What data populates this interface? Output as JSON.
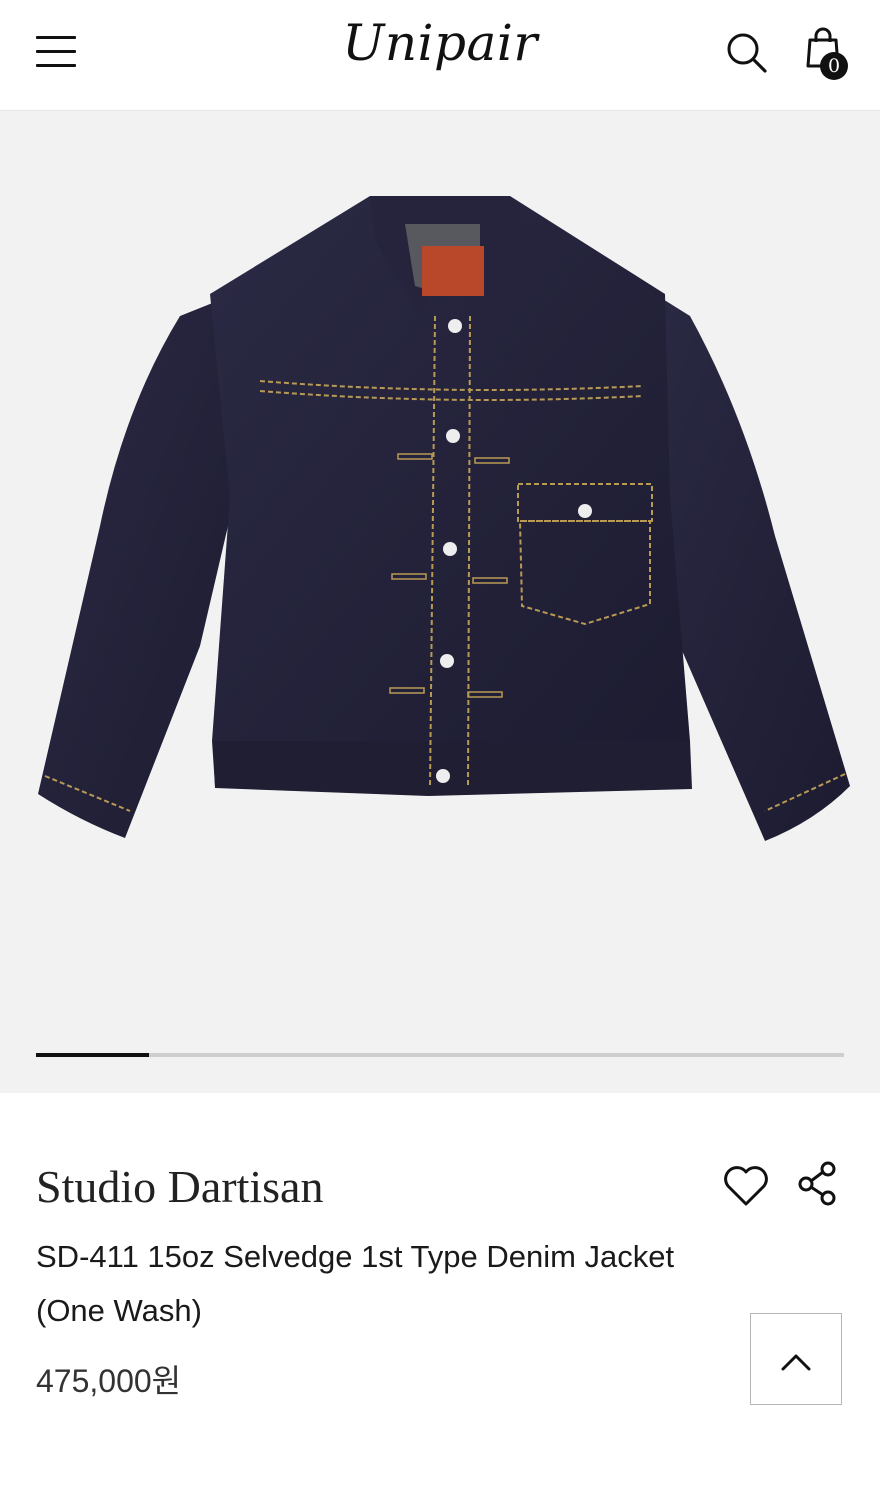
{
  "header": {
    "logo": "Unipair",
    "cart_count": "0",
    "icons": {
      "menu": "hamburger-menu-icon",
      "search": "search-icon",
      "cart": "shopping-bag-icon"
    }
  },
  "gallery": {
    "image": "denim-jacket-product-photo",
    "background": "#f3f2f3",
    "progress_fraction": 0.14
  },
  "product": {
    "brand": "Studio Dartisan",
    "name": "SD-411 15oz Selvedge 1st Type Denim Jacket (One Wash)",
    "price": "475,000원",
    "icons": {
      "wishlist": "heart-icon",
      "share": "share-icon",
      "scroll_top": "chevron-up-icon"
    }
  },
  "colors": {
    "denim": "#23223a",
    "stitch": "#b99a55",
    "ink": "#111111"
  }
}
